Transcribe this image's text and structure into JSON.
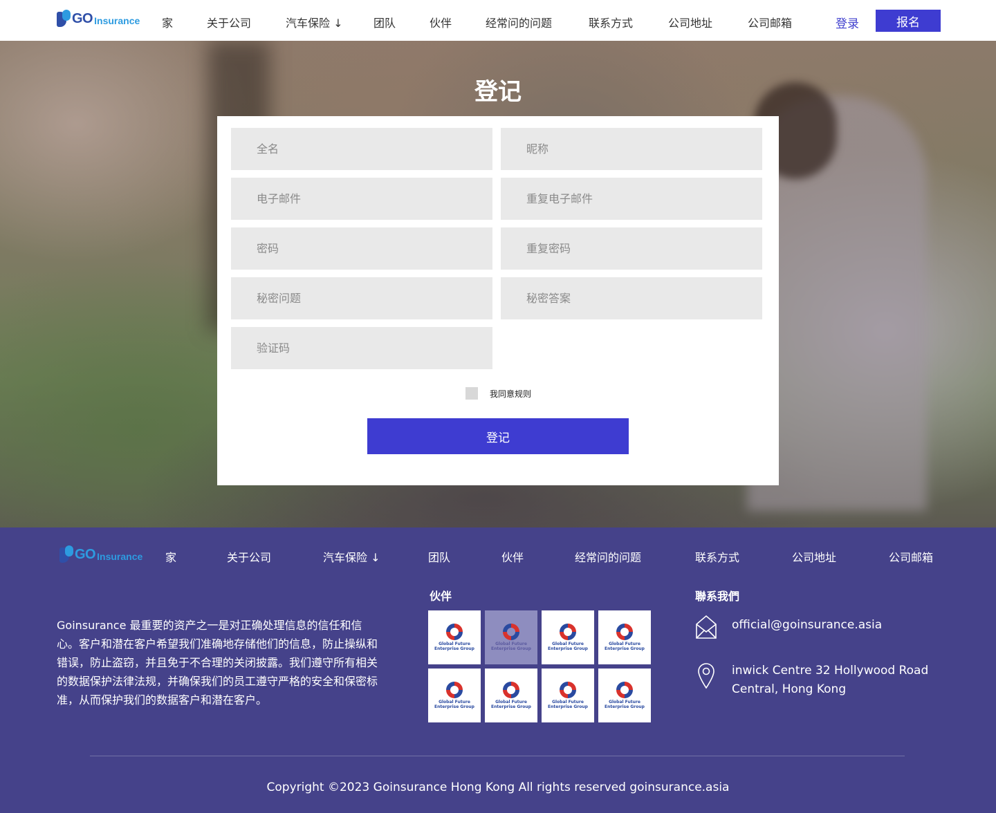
{
  "header": {
    "logo": {
      "go": "GO",
      "insurance": "Insurance"
    },
    "nav": [
      "家",
      "关于公司",
      "汽车保险 ↓",
      "团队",
      "伙伴",
      "经常问的问题",
      "联系方式",
      "公司地址",
      "公司邮箱"
    ],
    "login": "登录",
    "signup": "报名"
  },
  "hero": {
    "title": "登记"
  },
  "form": {
    "placeholders": {
      "full_name": "全名",
      "nickname": "昵称",
      "email": "电子邮件",
      "repeat_email": "重复电子邮件",
      "password": "密码",
      "repeat_password": "重复密码",
      "secret_question": "秘密问题",
      "secret_answer": "秘密答案",
      "captcha": "验证码"
    },
    "agree_label": "我同意规则",
    "submit_label": "登记"
  },
  "footer": {
    "logo": {
      "go": "GO",
      "insurance": "Insurance"
    },
    "nav": [
      "家",
      "关于公司",
      "汽车保险 ↓",
      "团队",
      "伙伴",
      "经常问的问题",
      "联系方式",
      "公司地址",
      "公司邮箱"
    ],
    "about": "Goinsurance 最重要的资产之一是对正确处理信息的信任和信心。客户和潜在客户希望我们准确地存储他们的信息，防止操纵和错误，防止盗窃，并且免于不合理的关闭披露。我们遵守所有相关的数据保护法律法规，并确保我们的员工遵守严格的安全和保密标准，从而保护我们的数据客户和潜在客户。",
    "partners_title": "伙伴",
    "partners": [
      {
        "name": "Global Future Enterprise Group"
      },
      {
        "name": "Global Future Enterprise Group"
      },
      {
        "name": "Global Future Enterprise Group"
      },
      {
        "name": "Global Future Enterprise Group"
      },
      {
        "name": "Global Future Enterprise Group"
      },
      {
        "name": "Global Future Enterprise Group"
      },
      {
        "name": "Global Future Enterprise Group"
      },
      {
        "name": "Global Future Enterprise Group"
      }
    ],
    "contact_title": "聯系我們",
    "email": "official@goinsurance.asia",
    "address_line1": "inwick Centre 32 Hollywood Road",
    "address_line2": "Central, Hong Kong",
    "copyright": "Copyright ©2023 Goinsurance Hong Kong All rights reserved goinsurance.asia"
  },
  "colors": {
    "accent": "#3e3cd1",
    "footer_bg": "#45428a",
    "field_bg": "#e9e9e9"
  }
}
